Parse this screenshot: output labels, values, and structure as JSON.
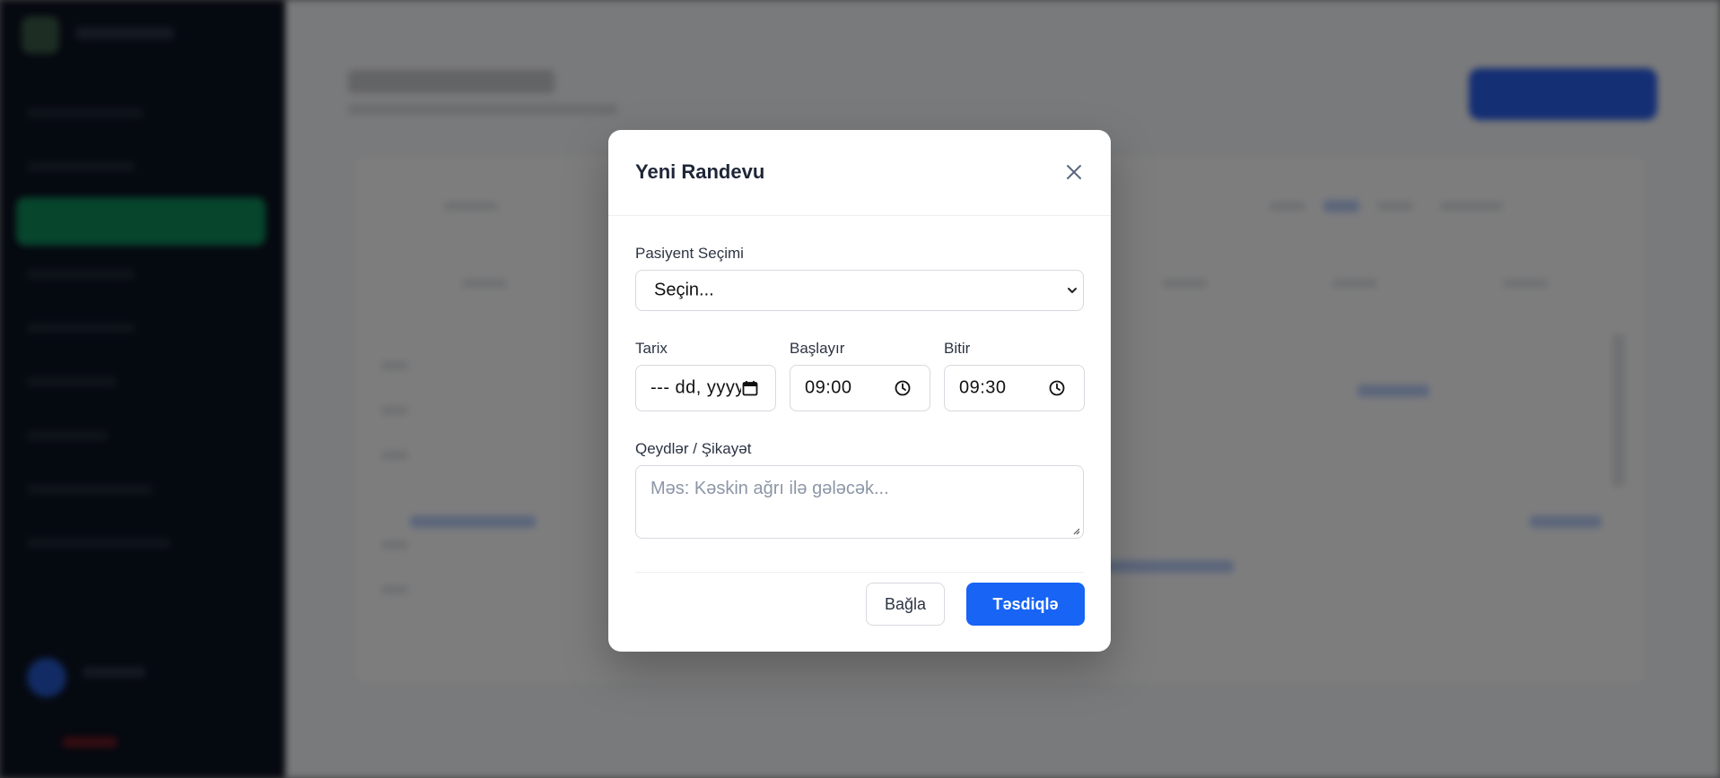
{
  "modal": {
    "title": "Yeni Randevu",
    "patient_label": "Pasiyent Seçimi",
    "patient_value": "Seçin...",
    "date_label": "Tarix",
    "date_value": "--- dd, yyyy",
    "start_label": "Başlayır",
    "start_value": "09:00",
    "end_label": "Bitir",
    "end_value": "09:30",
    "notes_label": "Qeydlər / Şikayət",
    "notes_placeholder": "Məs: Kəskin ağrı ilə gələcək...",
    "cancel_label": "Bağla",
    "confirm_label": "Təsdiqlə"
  },
  "colors": {
    "primary": "#1764f5",
    "overlay": "rgba(0,0,0,0.5)",
    "sidebar": "#0b1220",
    "sidebar_active": "#0f8a5a"
  },
  "icons": [
    "close-icon",
    "chevron-down-icon",
    "calendar-icon",
    "clock-icon"
  ]
}
